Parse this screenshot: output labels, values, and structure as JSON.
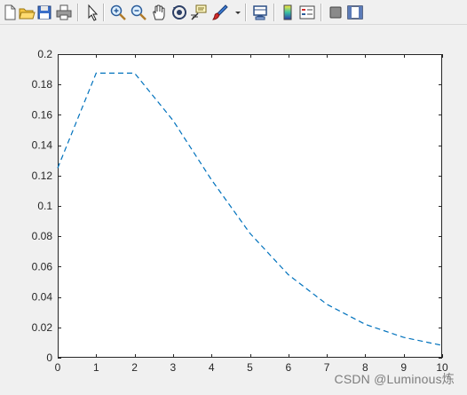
{
  "toolbar": {
    "buttons": [
      {
        "name": "new-figure-icon",
        "tooltip": "New Figure"
      },
      {
        "name": "open-file-icon",
        "tooltip": "Open File"
      },
      {
        "name": "save-figure-icon",
        "tooltip": "Save Figure"
      },
      {
        "name": "print-figure-icon",
        "tooltip": "Print Figure"
      },
      {
        "name": "edit-plot-icon",
        "tooltip": "Edit Plot"
      },
      {
        "name": "zoom-in-icon",
        "tooltip": "Zoom In"
      },
      {
        "name": "zoom-out-icon",
        "tooltip": "Zoom Out"
      },
      {
        "name": "pan-icon",
        "tooltip": "Pan"
      },
      {
        "name": "rotate-3d-icon",
        "tooltip": "Rotate 3D"
      },
      {
        "name": "data-cursor-icon",
        "tooltip": "Data Cursor"
      },
      {
        "name": "brush-icon",
        "tooltip": "Brush/Select Data"
      },
      {
        "name": "link-plot-icon",
        "tooltip": "Link Plot"
      },
      {
        "name": "insert-colorbar-icon",
        "tooltip": "Insert Colorbar"
      },
      {
        "name": "insert-legend-icon",
        "tooltip": "Insert Legend"
      },
      {
        "name": "hide-plot-tools-icon",
        "tooltip": "Hide Plot Tools"
      },
      {
        "name": "show-plot-tools-icon",
        "tooltip": "Show Plot Tools and Dock Figure"
      }
    ]
  },
  "chart_data": {
    "type": "line",
    "title": "",
    "xlabel": "",
    "ylabel": "",
    "xlim": [
      0,
      10
    ],
    "ylim": [
      0,
      0.2
    ],
    "x_ticks": [
      "0",
      "1",
      "2",
      "3",
      "4",
      "5",
      "6",
      "7",
      "8",
      "9",
      "10"
    ],
    "y_ticks": [
      "0",
      "0.02",
      "0.04",
      "0.06",
      "0.08",
      "0.1",
      "0.12",
      "0.14",
      "0.16",
      "0.18",
      "0.2"
    ],
    "grid": false,
    "line_style": "dashed",
    "series_color": "#0072bd",
    "x": [
      0,
      1,
      2,
      3,
      4,
      5,
      6,
      7,
      8,
      9,
      10
    ],
    "y": [
      0.125,
      0.1875,
      0.1875,
      0.1563,
      0.1172,
      0.082,
      0.0547,
      0.0352,
      0.022,
      0.0134,
      0.0081
    ]
  },
  "watermark": "CSDN @Luminous炼"
}
